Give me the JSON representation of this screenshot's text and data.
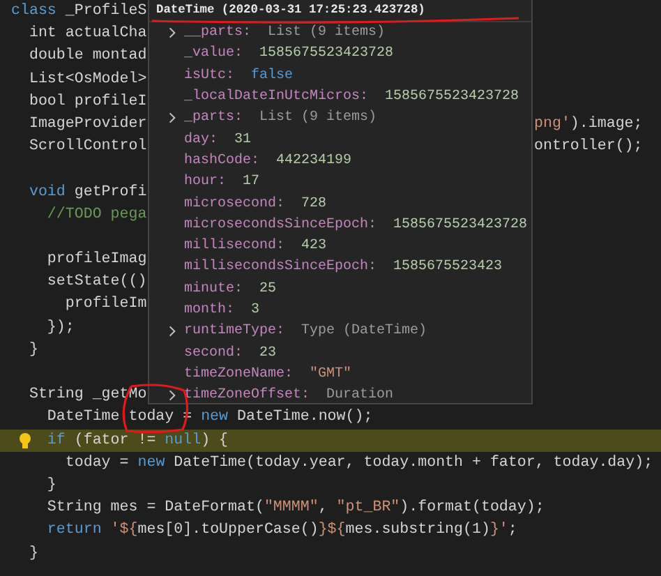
{
  "editor": {
    "lines": [
      {
        "kind": "code",
        "tokens": [
          {
            "text": "class",
            "kind": "kw"
          },
          {
            "text": " _ProfileS",
            "kind": "pl"
          }
        ]
      },
      {
        "kind": "code",
        "tokens": [
          {
            "text": "  int actualCha",
            "kind": "pl"
          }
        ]
      },
      {
        "kind": "code",
        "tokens": [
          {
            "text": "  double montad",
            "kind": "pl"
          }
        ]
      },
      {
        "kind": "code",
        "tokens": [
          {
            "text": "  List<OsModel>",
            "kind": "pl"
          }
        ]
      },
      {
        "kind": "code",
        "tokens": [
          {
            "text": "  bool profileI",
            "kind": "pl"
          }
        ]
      },
      {
        "kind": "code",
        "tokens": [
          {
            "text": "  ImageProvider",
            "kind": "pl"
          }
        ],
        "tail": [
          {
            "text": "png'",
            "kind": "str"
          },
          {
            "text": ").image;",
            "kind": "pl"
          }
        ]
      },
      {
        "kind": "code",
        "tokens": [
          {
            "text": "  ScrollControl",
            "kind": "pl"
          }
        ],
        "tail": [
          {
            "text": "ontroller();",
            "kind": "pl"
          }
        ]
      },
      {
        "kind": "blank"
      },
      {
        "kind": "code",
        "tokens": [
          {
            "text": "  void",
            "kind": "kw"
          },
          {
            "text": " getProfi",
            "kind": "pl"
          }
        ]
      },
      {
        "kind": "code",
        "tokens": [
          {
            "text": "    //TODO pega",
            "kind": "cm"
          }
        ]
      },
      {
        "kind": "blank"
      },
      {
        "kind": "code",
        "tokens": [
          {
            "text": "    profileImag",
            "kind": "pl"
          }
        ]
      },
      {
        "kind": "code",
        "tokens": [
          {
            "text": "    setState(()",
            "kind": "pl"
          }
        ]
      },
      {
        "kind": "code",
        "tokens": [
          {
            "text": "      profileIm",
            "kind": "pl"
          }
        ]
      },
      {
        "kind": "code",
        "tokens": [
          {
            "text": "    });",
            "kind": "pl"
          }
        ]
      },
      {
        "kind": "code",
        "tokens": [
          {
            "text": "  }",
            "kind": "pl"
          }
        ]
      },
      {
        "kind": "blank"
      },
      {
        "kind": "code",
        "tokens": [
          {
            "text": "  String _getMo",
            "kind": "pl"
          }
        ]
      },
      {
        "kind": "code",
        "tokens": [
          {
            "text": "    DateTime today = ",
            "kind": "pl"
          },
          {
            "text": "new",
            "kind": "kw"
          },
          {
            "text": " DateTime.now();",
            "kind": "pl"
          }
        ]
      },
      {
        "kind": "code",
        "tokens": [
          {
            "text": "    if",
            "kind": "kw"
          },
          {
            "text": " (fator != ",
            "kind": "pl"
          },
          {
            "text": "null",
            "kind": "kw"
          },
          {
            "text": ") {",
            "kind": "pl"
          }
        ],
        "highlighted": true,
        "lightbulb": true
      },
      {
        "kind": "code",
        "tokens": [
          {
            "text": "      today = ",
            "kind": "pl"
          },
          {
            "text": "new",
            "kind": "kw"
          },
          {
            "text": " DateTime(today.year, today.month + fator, today.day);",
            "kind": "pl"
          }
        ]
      },
      {
        "kind": "code",
        "tokens": [
          {
            "text": "    }",
            "kind": "pl"
          }
        ]
      },
      {
        "kind": "code",
        "tokens": [
          {
            "text": "    String mes = DateFormat(",
            "kind": "pl"
          },
          {
            "text": "\"MMMM\"",
            "kind": "str"
          },
          {
            "text": ", ",
            "kind": "pl"
          },
          {
            "text": "\"pt_BR\"",
            "kind": "str"
          },
          {
            "text": ").format(today);",
            "kind": "pl"
          }
        ]
      },
      {
        "kind": "code",
        "tokens": [
          {
            "text": "    return ",
            "kind": "kw"
          },
          {
            "text": "'${",
            "kind": "str"
          },
          {
            "text": "mes[0].toUpperCase()",
            "kind": "pl"
          },
          {
            "text": "}${",
            "kind": "str"
          },
          {
            "text": "mes.substring(1)",
            "kind": "pl"
          },
          {
            "text": "}'",
            "kind": "str"
          },
          {
            "text": ";",
            "kind": "pl"
          }
        ]
      },
      {
        "kind": "code",
        "tokens": [
          {
            "text": "  }",
            "kind": "pl"
          }
        ]
      }
    ]
  },
  "hover": {
    "title": "DateTime (2020-03-31 17:25:23.423728)",
    "properties": [
      {
        "name": "__parts:",
        "value": "List (9 items)",
        "kind": "type",
        "expandable": true
      },
      {
        "name": "_value:",
        "value": "1585675523423728",
        "kind": "number",
        "expandable": false
      },
      {
        "name": "isUtc:",
        "value": "false",
        "kind": "bool",
        "expandable": false
      },
      {
        "name": "_localDateInUtcMicros:",
        "value": "1585675523423728",
        "kind": "number",
        "expandable": false
      },
      {
        "name": "_parts:",
        "value": "List (9 items)",
        "kind": "type",
        "expandable": true
      },
      {
        "name": "day:",
        "value": "31",
        "kind": "number",
        "expandable": false
      },
      {
        "name": "hashCode:",
        "value": "442234199",
        "kind": "number",
        "expandable": false
      },
      {
        "name": "hour:",
        "value": "17",
        "kind": "number",
        "expandable": false
      },
      {
        "name": "microsecond:",
        "value": "728",
        "kind": "number",
        "expandable": false
      },
      {
        "name": "microsecondsSinceEpoch:",
        "value": "1585675523423728",
        "kind": "number",
        "expandable": false
      },
      {
        "name": "millisecond:",
        "value": "423",
        "kind": "number",
        "expandable": false
      },
      {
        "name": "millisecondsSinceEpoch:",
        "value": "1585675523423",
        "kind": "number",
        "expandable": false
      },
      {
        "name": "minute:",
        "value": "25",
        "kind": "number",
        "expandable": false
      },
      {
        "name": "month:",
        "value": "3",
        "kind": "number",
        "expandable": false
      },
      {
        "name": "runtimeType:",
        "value": "Type (DateTime)",
        "kind": "type",
        "expandable": true
      },
      {
        "name": "second:",
        "value": "23",
        "kind": "number",
        "expandable": false
      },
      {
        "name": "timeZoneName:",
        "value": "\"GMT\"",
        "kind": "string",
        "expandable": false
      },
      {
        "name": "timeZoneOffset:",
        "value": "Duration",
        "kind": "type",
        "expandable": true
      }
    ]
  }
}
